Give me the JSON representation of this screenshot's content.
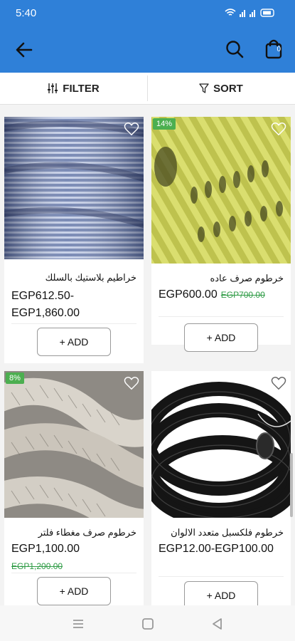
{
  "status": {
    "time": "5:40",
    "icons": "wifi signal battery"
  },
  "appbar": {
    "cart_count": "0"
  },
  "toolbar": {
    "filter_label": "FILTER",
    "sort_label": "SORT"
  },
  "products": [
    {
      "name": "خراطيم بلاستيك بالسلك",
      "price": "EGP612.50-EGP1,860.00",
      "old_price": "",
      "badge": "",
      "add_label": "+ ADD"
    },
    {
      "name": "خرطوم صرف عاده",
      "price": "EGP600.00",
      "old_price": "EGP700.00",
      "badge": "14%",
      "add_label": "+ ADD"
    },
    {
      "name": "خرطوم صرف مغطاء فلتر",
      "price": "EGP1,100.00",
      "old_price": "EGP1,200.00",
      "badge": "8%",
      "add_label": "+ ADD"
    },
    {
      "name": "خرطوم فلكسبل متعدد الالوان",
      "price": "EGP12.00-EGP100.00",
      "old_price": "",
      "badge": "",
      "add_label": "+ ADD"
    }
  ],
  "colors": {
    "primary": "#2f80d8",
    "badge": "#4caf50",
    "old_price": "#2e9b45"
  }
}
